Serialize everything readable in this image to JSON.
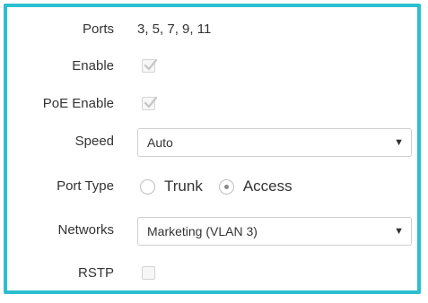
{
  "form": {
    "ports": {
      "label": "Ports",
      "value": "3, 5, 7, 9, 11"
    },
    "enable": {
      "label": "Enable",
      "checked": true,
      "disabled": true
    },
    "poe_enable": {
      "label": "PoE Enable",
      "checked": true,
      "disabled": true
    },
    "speed": {
      "label": "Speed",
      "selected": "Auto"
    },
    "port_type": {
      "label": "Port Type",
      "options": [
        {
          "label": "Trunk",
          "checked": false
        },
        {
          "label": "Access",
          "checked": true
        }
      ]
    },
    "networks": {
      "label": "Networks",
      "selected": "Marketing (VLAN 3)"
    },
    "rstp": {
      "label": "RSTP",
      "checked": false
    }
  },
  "icons": {
    "select_caret": "▼",
    "checkmark": "checkmark-icon"
  },
  "colors": {
    "border_accent": "#2bbfd0",
    "text": "#333333",
    "checkbox_mark": "#c8c8c8"
  }
}
